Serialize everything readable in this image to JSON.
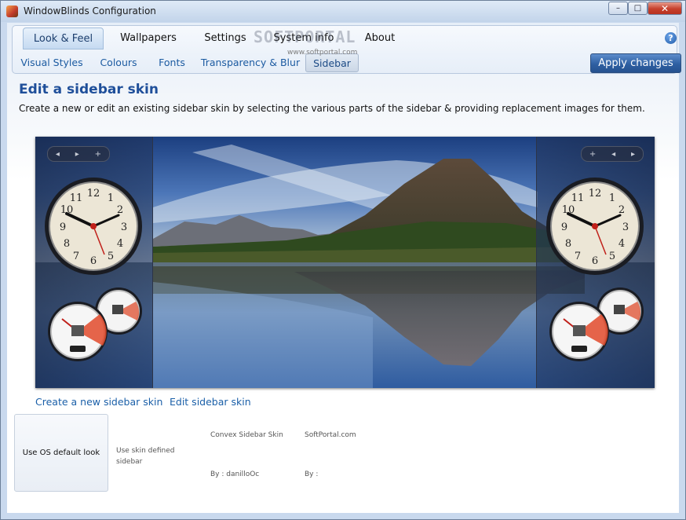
{
  "window": {
    "title": "WindowBlinds Configuration",
    "controls": {
      "minimize": "–",
      "maximize": "□",
      "close": "✕"
    }
  },
  "main_tabs": [
    {
      "label": "Look & Feel",
      "active": true
    },
    {
      "label": "Wallpapers",
      "active": false
    },
    {
      "label": "Settings",
      "active": false
    },
    {
      "label": "System info",
      "active": false
    },
    {
      "label": "About",
      "active": false
    }
  ],
  "sub_tabs": [
    {
      "label": "Visual Styles",
      "active": false
    },
    {
      "label": "Colours",
      "active": false
    },
    {
      "label": "Fonts",
      "active": false
    },
    {
      "label": "Transparency & Blur",
      "active": false
    },
    {
      "label": "Sidebar",
      "active": true
    }
  ],
  "help_glyph": "?",
  "apply_button": "Apply changes",
  "watermark": {
    "logo": "SOFTPORTAL",
    "url": "www.softportal.com"
  },
  "section": {
    "title": "Edit a sidebar skin",
    "description": "Create a new or edit an existing sidebar skin by selecting the various parts of the sidebar & providing replacement images for them."
  },
  "preview": {
    "left_toolbar": {
      "prev": "◂",
      "next": "▸",
      "add": "+"
    },
    "right_toolbar": {
      "add": "+",
      "prev": "◂",
      "next": "▸"
    }
  },
  "links": {
    "create": "Create a new sidebar skin",
    "edit": "Edit sidebar skin"
  },
  "skins": {
    "default_look": "Use OS default look",
    "skin_defined": "Use skin defined sidebar",
    "items": [
      {
        "name": "Convex Sidebar Skin",
        "author": "By : danilloOc"
      },
      {
        "name": "SoftPortal.com",
        "author": "By :"
      }
    ]
  },
  "colors": {
    "accent": "#1f4f9a",
    "link": "#1a5fa8",
    "apply_bg": "#2e5fa2",
    "close_button": "#c6402c"
  }
}
